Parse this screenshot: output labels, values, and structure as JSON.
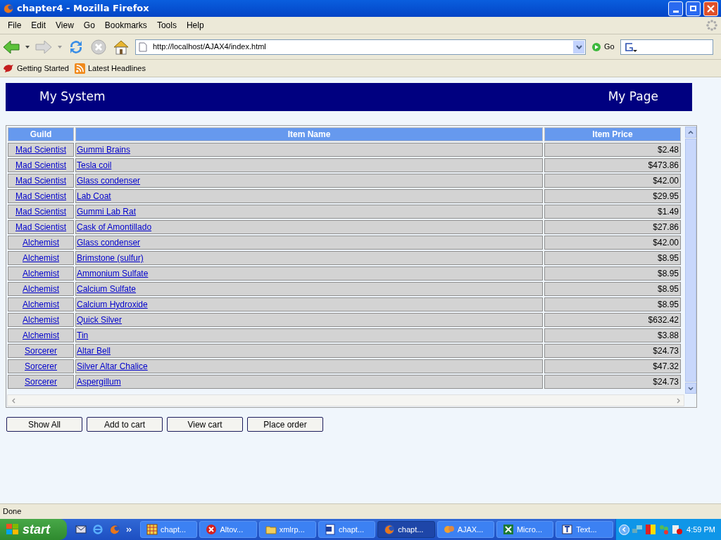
{
  "window": {
    "title": "chapter4 - Mozilla Firefox"
  },
  "menu": [
    "File",
    "Edit",
    "View",
    "Go",
    "Bookmarks",
    "Tools",
    "Help"
  ],
  "address": {
    "value": "http://localhost/AJAX4/index.html"
  },
  "go_button": "Go",
  "bookmarks": [
    {
      "label": "Getting Started",
      "kind": "page"
    },
    {
      "label": "Latest Headlines",
      "kind": "feed"
    }
  ],
  "page": {
    "header": {
      "left": "My System",
      "right": "My Page"
    },
    "table": {
      "columns": [
        "Guild",
        "Item Name",
        "Item Price"
      ],
      "rows": [
        {
          "guild": "Mad Scientist",
          "item": "Gummi Brains",
          "price": "$2.48"
        },
        {
          "guild": "Mad Scientist",
          "item": "Tesla coil",
          "price": "$473.86"
        },
        {
          "guild": "Mad Scientist",
          "item": "Glass condenser",
          "price": "$42.00"
        },
        {
          "guild": "Mad Scientist",
          "item": "Lab Coat",
          "price": "$29.95"
        },
        {
          "guild": "Mad Scientist",
          "item": "Gummi Lab Rat",
          "price": "$1.49"
        },
        {
          "guild": "Mad Scientist",
          "item": "Cask of Amontillado",
          "price": "$27.86"
        },
        {
          "guild": "Alchemist",
          "item": "Glass condenser",
          "price": "$42.00"
        },
        {
          "guild": "Alchemist",
          "item": "Brimstone (sulfur)",
          "price": "$8.95"
        },
        {
          "guild": "Alchemist",
          "item": "Ammonium Sulfate",
          "price": "$8.95"
        },
        {
          "guild": "Alchemist",
          "item": "Calcium Sulfate",
          "price": "$8.95"
        },
        {
          "guild": "Alchemist",
          "item": "Calcium Hydroxide",
          "price": "$8.95"
        },
        {
          "guild": "Alchemist",
          "item": "Quick Silver",
          "price": "$632.42"
        },
        {
          "guild": "Alchemist",
          "item": "Tin",
          "price": "$3.88"
        },
        {
          "guild": "Sorcerer",
          "item": "Altar Bell",
          "price": "$24.73"
        },
        {
          "guild": "Sorcerer",
          "item": "Silver Altar Chalice",
          "price": "$47.32"
        },
        {
          "guild": "Sorcerer",
          "item": "Aspergillum",
          "price": "$24.73"
        }
      ]
    },
    "buttons": [
      "Show All",
      "Add to cart",
      "View cart",
      "Place order"
    ]
  },
  "status_bar": "Done",
  "taskbar": {
    "start": "start",
    "items": [
      {
        "label": "chapt...",
        "kind": "grid",
        "selected": false
      },
      {
        "label": "Altov...",
        "kind": "error",
        "selected": false
      },
      {
        "label": "xmlrp...",
        "kind": "folder",
        "selected": false
      },
      {
        "label": "chapt...",
        "kind": "word",
        "selected": false
      },
      {
        "label": "chapt...",
        "kind": "firefox",
        "selected": true
      },
      {
        "label": "AJAX...",
        "kind": "paint",
        "selected": false
      },
      {
        "label": "Micro...",
        "kind": "excel",
        "selected": false
      },
      {
        "label": "Text...",
        "kind": "text",
        "selected": false
      }
    ],
    "clock": "4:59 PM"
  }
}
